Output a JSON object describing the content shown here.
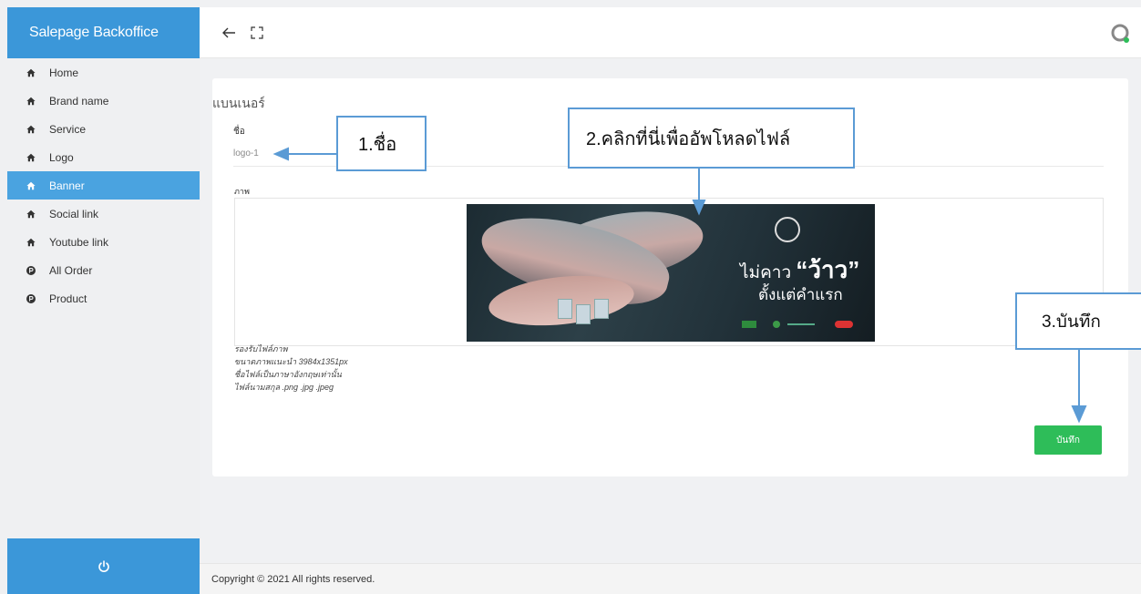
{
  "app": {
    "title": "Salepage Backoffice"
  },
  "sidebar": {
    "items": [
      {
        "label": "Home",
        "icon": "home-icon",
        "active": false
      },
      {
        "label": "Brand name",
        "icon": "home-icon",
        "active": false
      },
      {
        "label": "Service",
        "icon": "home-icon",
        "active": false
      },
      {
        "label": "Logo",
        "icon": "home-icon",
        "active": false
      },
      {
        "label": "Banner",
        "icon": "home-icon",
        "active": true
      },
      {
        "label": "Social link",
        "icon": "home-icon",
        "active": false
      },
      {
        "label": "Youtube link",
        "icon": "home-icon",
        "active": false
      },
      {
        "label": "All Order",
        "icon": "p-circle-icon",
        "active": false
      },
      {
        "label": "Product",
        "icon": "p-circle-icon",
        "active": false
      }
    ],
    "logout_icon": "power-icon"
  },
  "topbar": {
    "back_icon": "arrow-left-icon",
    "fullscreen_icon": "expand-icon",
    "avatar_icon": "user-avatar-icon"
  },
  "form": {
    "title": "แบนเนอร์",
    "name_label": "ชื่อ",
    "name_value": "logo-1",
    "image_label": "ภาพ",
    "banner": {
      "text_prefix": "ไม่คาว",
      "text_highlight": "“ว้าว”",
      "text_line2": "ตั้งแต่คำแรก"
    },
    "notes": "รองรับไฟล์ภาพ\nขนาดภาพแนะนำ 3984x1351px\nชื่อไฟล์เป็นภาษาอังกฤษเท่านั้น\nไฟล์นามสกุล .png .jpg .jpeg",
    "save_label": "บันทึก"
  },
  "footer": {
    "copyright": "Copyright © 2021 All rights reserved."
  },
  "annotations": {
    "step1": "1.ชื่อ",
    "step2": "2.คลิกที่นี่เพื่ออัพโหลดไฟล์",
    "step3": "3.บันทึก"
  },
  "colors": {
    "brand": "#3b97d9",
    "active_menu": "#4aa3e0",
    "save": "#2ebd59",
    "annotation_border": "#5b9bd5",
    "online_dot": "#2ebd59"
  }
}
